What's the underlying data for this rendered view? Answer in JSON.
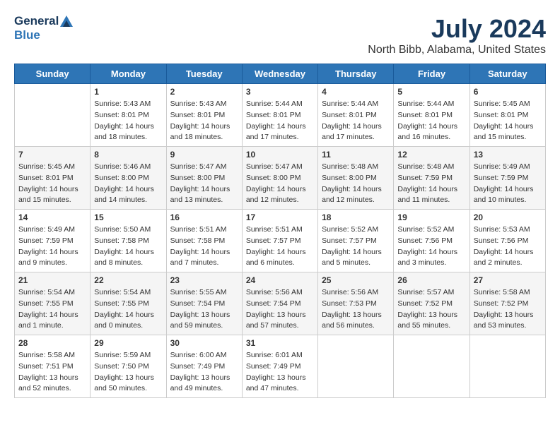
{
  "header": {
    "logo_general": "General",
    "logo_blue": "Blue",
    "month": "July 2024",
    "location": "North Bibb, Alabama, United States"
  },
  "days_of_week": [
    "Sunday",
    "Monday",
    "Tuesday",
    "Wednesday",
    "Thursday",
    "Friday",
    "Saturday"
  ],
  "weeks": [
    [
      {
        "day": "",
        "content": ""
      },
      {
        "day": "1",
        "content": "Sunrise: 5:43 AM\nSunset: 8:01 PM\nDaylight: 14 hours\nand 18 minutes."
      },
      {
        "day": "2",
        "content": "Sunrise: 5:43 AM\nSunset: 8:01 PM\nDaylight: 14 hours\nand 18 minutes."
      },
      {
        "day": "3",
        "content": "Sunrise: 5:44 AM\nSunset: 8:01 PM\nDaylight: 14 hours\nand 17 minutes."
      },
      {
        "day": "4",
        "content": "Sunrise: 5:44 AM\nSunset: 8:01 PM\nDaylight: 14 hours\nand 17 minutes."
      },
      {
        "day": "5",
        "content": "Sunrise: 5:44 AM\nSunset: 8:01 PM\nDaylight: 14 hours\nand 16 minutes."
      },
      {
        "day": "6",
        "content": "Sunrise: 5:45 AM\nSunset: 8:01 PM\nDaylight: 14 hours\nand 15 minutes."
      }
    ],
    [
      {
        "day": "7",
        "content": "Sunrise: 5:45 AM\nSunset: 8:01 PM\nDaylight: 14 hours\nand 15 minutes."
      },
      {
        "day": "8",
        "content": "Sunrise: 5:46 AM\nSunset: 8:00 PM\nDaylight: 14 hours\nand 14 minutes."
      },
      {
        "day": "9",
        "content": "Sunrise: 5:47 AM\nSunset: 8:00 PM\nDaylight: 14 hours\nand 13 minutes."
      },
      {
        "day": "10",
        "content": "Sunrise: 5:47 AM\nSunset: 8:00 PM\nDaylight: 14 hours\nand 12 minutes."
      },
      {
        "day": "11",
        "content": "Sunrise: 5:48 AM\nSunset: 8:00 PM\nDaylight: 14 hours\nand 12 minutes."
      },
      {
        "day": "12",
        "content": "Sunrise: 5:48 AM\nSunset: 7:59 PM\nDaylight: 14 hours\nand 11 minutes."
      },
      {
        "day": "13",
        "content": "Sunrise: 5:49 AM\nSunset: 7:59 PM\nDaylight: 14 hours\nand 10 minutes."
      }
    ],
    [
      {
        "day": "14",
        "content": "Sunrise: 5:49 AM\nSunset: 7:59 PM\nDaylight: 14 hours\nand 9 minutes."
      },
      {
        "day": "15",
        "content": "Sunrise: 5:50 AM\nSunset: 7:58 PM\nDaylight: 14 hours\nand 8 minutes."
      },
      {
        "day": "16",
        "content": "Sunrise: 5:51 AM\nSunset: 7:58 PM\nDaylight: 14 hours\nand 7 minutes."
      },
      {
        "day": "17",
        "content": "Sunrise: 5:51 AM\nSunset: 7:57 PM\nDaylight: 14 hours\nand 6 minutes."
      },
      {
        "day": "18",
        "content": "Sunrise: 5:52 AM\nSunset: 7:57 PM\nDaylight: 14 hours\nand 5 minutes."
      },
      {
        "day": "19",
        "content": "Sunrise: 5:52 AM\nSunset: 7:56 PM\nDaylight: 14 hours\nand 3 minutes."
      },
      {
        "day": "20",
        "content": "Sunrise: 5:53 AM\nSunset: 7:56 PM\nDaylight: 14 hours\nand 2 minutes."
      }
    ],
    [
      {
        "day": "21",
        "content": "Sunrise: 5:54 AM\nSunset: 7:55 PM\nDaylight: 14 hours\nand 1 minute."
      },
      {
        "day": "22",
        "content": "Sunrise: 5:54 AM\nSunset: 7:55 PM\nDaylight: 14 hours\nand 0 minutes."
      },
      {
        "day": "23",
        "content": "Sunrise: 5:55 AM\nSunset: 7:54 PM\nDaylight: 13 hours\nand 59 minutes."
      },
      {
        "day": "24",
        "content": "Sunrise: 5:56 AM\nSunset: 7:54 PM\nDaylight: 13 hours\nand 57 minutes."
      },
      {
        "day": "25",
        "content": "Sunrise: 5:56 AM\nSunset: 7:53 PM\nDaylight: 13 hours\nand 56 minutes."
      },
      {
        "day": "26",
        "content": "Sunrise: 5:57 AM\nSunset: 7:52 PM\nDaylight: 13 hours\nand 55 minutes."
      },
      {
        "day": "27",
        "content": "Sunrise: 5:58 AM\nSunset: 7:52 PM\nDaylight: 13 hours\nand 53 minutes."
      }
    ],
    [
      {
        "day": "28",
        "content": "Sunrise: 5:58 AM\nSunset: 7:51 PM\nDaylight: 13 hours\nand 52 minutes."
      },
      {
        "day": "29",
        "content": "Sunrise: 5:59 AM\nSunset: 7:50 PM\nDaylight: 13 hours\nand 50 minutes."
      },
      {
        "day": "30",
        "content": "Sunrise: 6:00 AM\nSunset: 7:49 PM\nDaylight: 13 hours\nand 49 minutes."
      },
      {
        "day": "31",
        "content": "Sunrise: 6:01 AM\nSunset: 7:49 PM\nDaylight: 13 hours\nand 47 minutes."
      },
      {
        "day": "",
        "content": ""
      },
      {
        "day": "",
        "content": ""
      },
      {
        "day": "",
        "content": ""
      }
    ]
  ]
}
